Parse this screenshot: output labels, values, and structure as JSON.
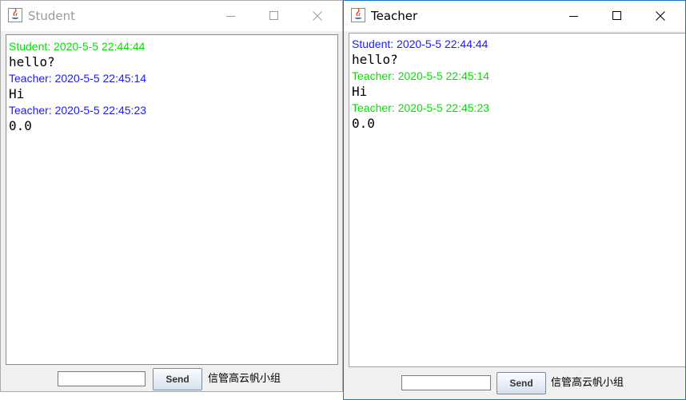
{
  "colors": {
    "blue": "#1a1aff",
    "green": "#00e000"
  },
  "windows": [
    {
      "title": "Student",
      "active": false,
      "messages": [
        {
          "header": "Student: 2020-5-5 22:44:44",
          "color": "#00e000",
          "body": "hello?"
        },
        {
          "header": "Teacher: 2020-5-5 22:45:14",
          "color": "#1a1aff",
          "body": "Hi"
        },
        {
          "header": "Teacher: 2020-5-5 22:45:23",
          "color": "#1a1aff",
          "body": "0.0"
        }
      ],
      "input_value": "",
      "send_label": "Send",
      "group_label": "信管高云帆小组"
    },
    {
      "title": "Teacher",
      "active": true,
      "messages": [
        {
          "header": "Student: 2020-5-5 22:44:44",
          "color": "#1a1aff",
          "body": "hello?"
        },
        {
          "header": "Teacher: 2020-5-5 22:45:14",
          "color": "#00e000",
          "body": "Hi"
        },
        {
          "header": "Teacher: 2020-5-5 22:45:23",
          "color": "#00e000",
          "body": "0.0"
        }
      ],
      "input_value": "",
      "send_label": "Send",
      "group_label": "信管高云帆小组"
    }
  ]
}
